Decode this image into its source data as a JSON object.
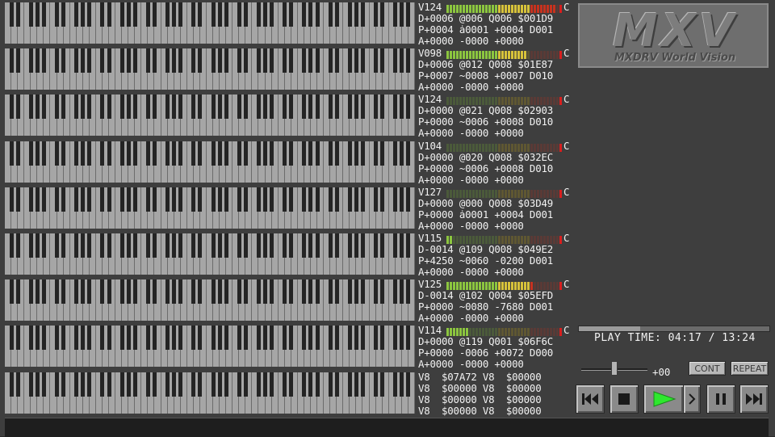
{
  "app": {
    "name": "MXDRV World Vision"
  },
  "logo": {
    "title": "MXV",
    "subtitle": "MXDRV World Vision"
  },
  "channels": [
    {
      "lines": [
        "V124",
        "D+0006 @006 Q006 $001D9",
        "P+0004 ȧ0001 +0004 D001",
        "A+0000 -0000 +0000"
      ],
      "level": 0.95,
      "key_label": "C"
    },
    {
      "lines": [
        "V098",
        "D+0006 @012 Q008 $01E87",
        "P+0007 ~0008 +0007 D010",
        "A+0000 -0000 +0000"
      ],
      "level": 0.7,
      "key_label": "C"
    },
    {
      "lines": [
        "V124",
        "D+0000 @021 Q008 $02903",
        "P+0000 ~0006 +0008 D010",
        "A+0000 -0000 +0000"
      ],
      "level": 0.0,
      "key_label": "C"
    },
    {
      "lines": [
        "V104",
        "D+0000 @020 Q008 $032EC",
        "P+0000 ~0006 +0008 D010",
        "A+0000 -0000 +0000"
      ],
      "level": 0.0,
      "key_label": "C"
    },
    {
      "lines": [
        "V127",
        "D+0000 @000 Q008 $03D49",
        "P+0000 ȧ0001 +0004 D001",
        "A+0000 -0000 +0000"
      ],
      "level": 0.0,
      "key_label": "C"
    },
    {
      "lines": [
        "V115",
        "D-0014 @109 Q008 $049E2",
        "P+4250 ~0060 -0200 D001",
        "A+0000 -0000 +0000"
      ],
      "level": 0.06,
      "key_label": "C"
    },
    {
      "lines": [
        "V125",
        "D-0014 @102 Q004 $05EFD",
        "P+0000 ~0080 -7680 D001",
        "A+0000 -0000 +0000"
      ],
      "level": 0.75,
      "key_label": "C"
    },
    {
      "lines": [
        "V114",
        "D+0000 @119 Q001 $06F6C",
        "P+0000 -0006 +0072 D000",
        "A+0000 -0000 +0000"
      ],
      "level": 0.2,
      "key_label": "C"
    }
  ],
  "pcm": {
    "lines": [
      "V8  $07A72 V8  $00000",
      "V8  $00000 V8  $00000",
      "V8  $00000 V8  $00000",
      "V8  $00000 V8  $00000"
    ]
  },
  "player": {
    "play_time_label": "PLAY TIME:",
    "elapsed": "04:17",
    "separator": "/",
    "total": "13:24",
    "progress": 0.32,
    "volume_value": "+00",
    "volume_level": 0.5,
    "cont_label": "CONT",
    "repeat_label": "REPEAT"
  },
  "controls": [
    {
      "name": "rewind-button",
      "icon": "rewind-icon"
    },
    {
      "name": "stop-button",
      "icon": "stop-icon"
    },
    {
      "name": "play-button",
      "icon": "play-icon"
    },
    {
      "name": "pause-button",
      "icon": "pause-icon"
    },
    {
      "name": "skip-forward-button",
      "icon": "skip-forward-icon"
    }
  ],
  "colors": {
    "background": "#3e3e3e",
    "key_white": "#a6a6a6",
    "key_black": "#242424",
    "meter_green": "#8cc63f",
    "meter_yellow": "#d7c23a",
    "meter_red": "#c8321e",
    "play_green": "#2ee82e"
  }
}
